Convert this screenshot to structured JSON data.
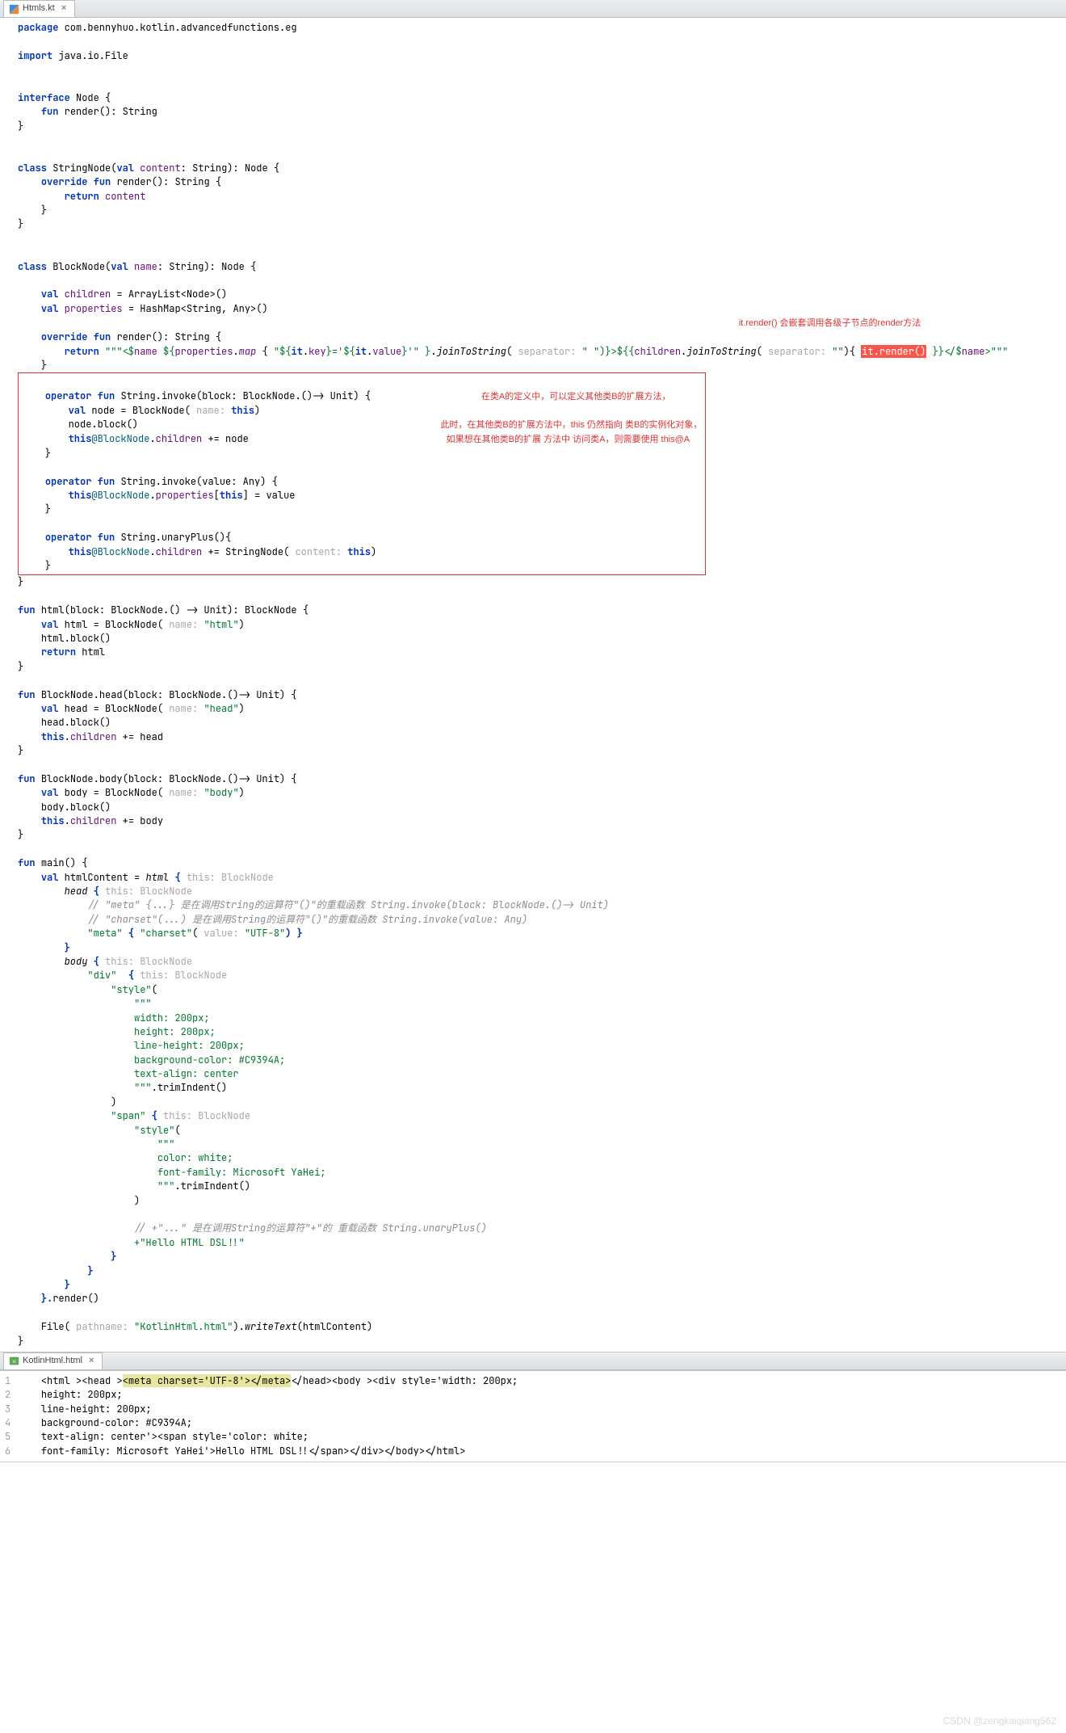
{
  "tabs": {
    "top": {
      "label": "Htmls.kt"
    },
    "bottom": {
      "label": "KotlinHtml.html"
    }
  },
  "kw": {
    "package": "package",
    "import": "import",
    "interface": "interface",
    "fun": "fun",
    "class": "class",
    "val": "val",
    "override": "override",
    "return": "return",
    "operator": "operator",
    "this": "this"
  },
  "code": {
    "pkg": "com.bennyhuo.kotlin.advancedfunctions.eg",
    "imp": "java.io.File",
    "node": "Node",
    "render": "render",
    "string_t": "String",
    "stringnode": "StringNode",
    "content": "content",
    "blocknode": "BlockNode",
    "name": "name",
    "children": "children",
    "arraylist": "ArrayList<Node>()",
    "properties": "properties",
    "hashmap": "HashMap<String, Any>()",
    "render_ret1": "\"\"\"<",
    "render_ret2": "${",
    "render_ret_props": ".",
    "render_map": "map",
    "render_lambda": " { ",
    "render_key": "\"${",
    "render_itkey": "it",
    "render_key2": ".",
    "render_key3": "key",
    "render_eq": "}='${",
    "render_val": "it",
    "render_val2": ".",
    "render_val3": "value",
    "render_end": "}'\" }",
    "render_join1": ".",
    "render_join1b": "joinToString",
    "render_sep": "( ",
    "render_sep_hint": "separator:",
    "render_sep_v": "\" \"",
    "render_mid": ")}>${{",
    "render_ch": ".",
    "render_join2": "joinToString",
    "render_sep2": "( ",
    "render_sep2_hint": "separator:",
    "render_sep2_v": "\"\"",
    "render_blk": "){ ",
    "render_itrender": "it.render()",
    "render_close": " }}</",
    "render_close2": ">\"\"\"",
    "op_invoke1_sig": "String.invoke(block: BlockNode.()-> Unit) {",
    "op_invoke1_l1a": "node = BlockNode(",
    "op_invoke1_hint": " name:",
    "op_invoke1_l1b": ")",
    "op_invoke1_l2": "node.block()",
    "op_invoke1_l3a": "@BlockNode",
    "op_invoke1_l3c": " += node",
    "op_invoke2_sig": "String.invoke(value: Any) {",
    "op_invoke2_l1a": "@BlockNode",
    "op_invoke2_l1c": "[",
    "op_invoke2_l1d": "] = value",
    "op_uplus_sig": "String.unaryPlus(){",
    "op_uplus_l1a": "@BlockNode",
    "op_uplus_l1c": " += StringNode(",
    "op_uplus_hint": " content:",
    "op_uplus_l1d": ")",
    "html_fn": "html(block: BlockNode.() -> Unit): BlockNode {",
    "html_l1a": "html = BlockNode(",
    "html_hint": " name:",
    "html_l1b": "\"html\"",
    "html_l1c": ")",
    "html_l2": "html.block()",
    "html_l3": "html",
    "head_fn": "BlockNode.head(block: BlockNode.()-> Unit) {",
    "head_l1a": "head = BlockNode(",
    "head_hint": " name:",
    "head_l1b": "\"head\"",
    "head_l1c": ")",
    "head_l2": "head.block()",
    "head_l3a": ".",
    "head_l3c": " += head",
    "body_fn": "BlockNode.body(block: BlockNode.()-> Unit) {",
    "body_l1a": "body = BlockNode(",
    "body_hint": " name:",
    "body_l1b": "\"body\"",
    "body_l1c": ")",
    "body_l2": "body.block()",
    "body_l3a": ".",
    "body_l3c": " += body",
    "main": "main() {",
    "main_l1": "htmlContent = ",
    "main_html": "html",
    "main_brace": " {",
    "main_thishint": " this: BlockNode",
    "main_head": "head",
    "main_head_brace": " {",
    "main_cmt1": "// \"meta\" {...} 是在调用String的运算符\"()\"的重载函数 String.invoke(block: BlockNode.()-> Unit)",
    "main_cmt2": "// \"charset\"(...) 是在调用String的运算符\"()\"的重载函数 String.invoke(value: Any)",
    "main_meta": "\"meta\"",
    "main_meta_brace": " { ",
    "main_charset": "\"charset\"",
    "main_charset_paren": "(",
    "main_vhint": " value:",
    "main_utf": "\"UTF-8\"",
    "main_meta_end": ") }",
    "main_body": "body",
    "main_body_brace": " {",
    "main_div": "\"div\"",
    "main_div_brace": "  {",
    "main_style": "\"style\"",
    "main_style_paren": "(",
    "css1": "\"\"\"",
    "css2": "width: 200px;",
    "css3": "height: 200px;",
    "css4": "line-height: 200px;",
    "css5": "background-color: #C9394A;",
    "css6": "text-align: center",
    "css7": "\"\"\"",
    "trim": ".trimIndent",
    "trim2": "()",
    "main_span": "\"span\"",
    "main_span_brace": " {",
    "css8": "color: white;",
    "css9": "font-family: Microsoft YaHei;",
    "main_cmt3": "// +\"...\" 是在调用String的运算符\"+\"的 重载函数 String.unaryPlus()",
    "main_hello": "+\"Hello HTML DSL!!\"",
    "main_render": "}.",
    "main_render2": "render",
    "main_render3": "()",
    "file_l": "File(",
    "file_hint": " pathname:",
    "file_name": "\"KotlinHtml.html\"",
    "file_l2": ").",
    "file_write": "writeText",
    "file_l3": "(htmlContent)"
  },
  "notes": {
    "n0": "it.render() 会嵌套调用各级子节点的render方法",
    "n1": "在类A的定义中，可以定义其他类B的扩展方法，",
    "n2": "此时，在其他类B的扩展方法中，this 仍然指向 类B的实例化对象，",
    "n3": "如果想在其他类B的扩展 方法中 访问类A，则需要使用 this@A"
  },
  "output": {
    "g1": "1",
    "g2": "2",
    "g3": "3",
    "g4": "4",
    "g5": "5",
    "g6": "6",
    "l1a": "<html ><head >",
    "l1_meta": "<meta charset='UTF-8'></meta>",
    "l1b": "</head><body ><div style='width: 200px;",
    "l2": "height: 200px;",
    "l3": "line-height: 200px;",
    "l4": "background-color: #C9394A;",
    "l5": "text-align: center'><span style='color: white;",
    "l6": "font-family: Microsoft YaHei'>Hello HTML DSL!!</span></div></body></html>"
  },
  "watermark": "CSDN @zengkaiqiang562"
}
